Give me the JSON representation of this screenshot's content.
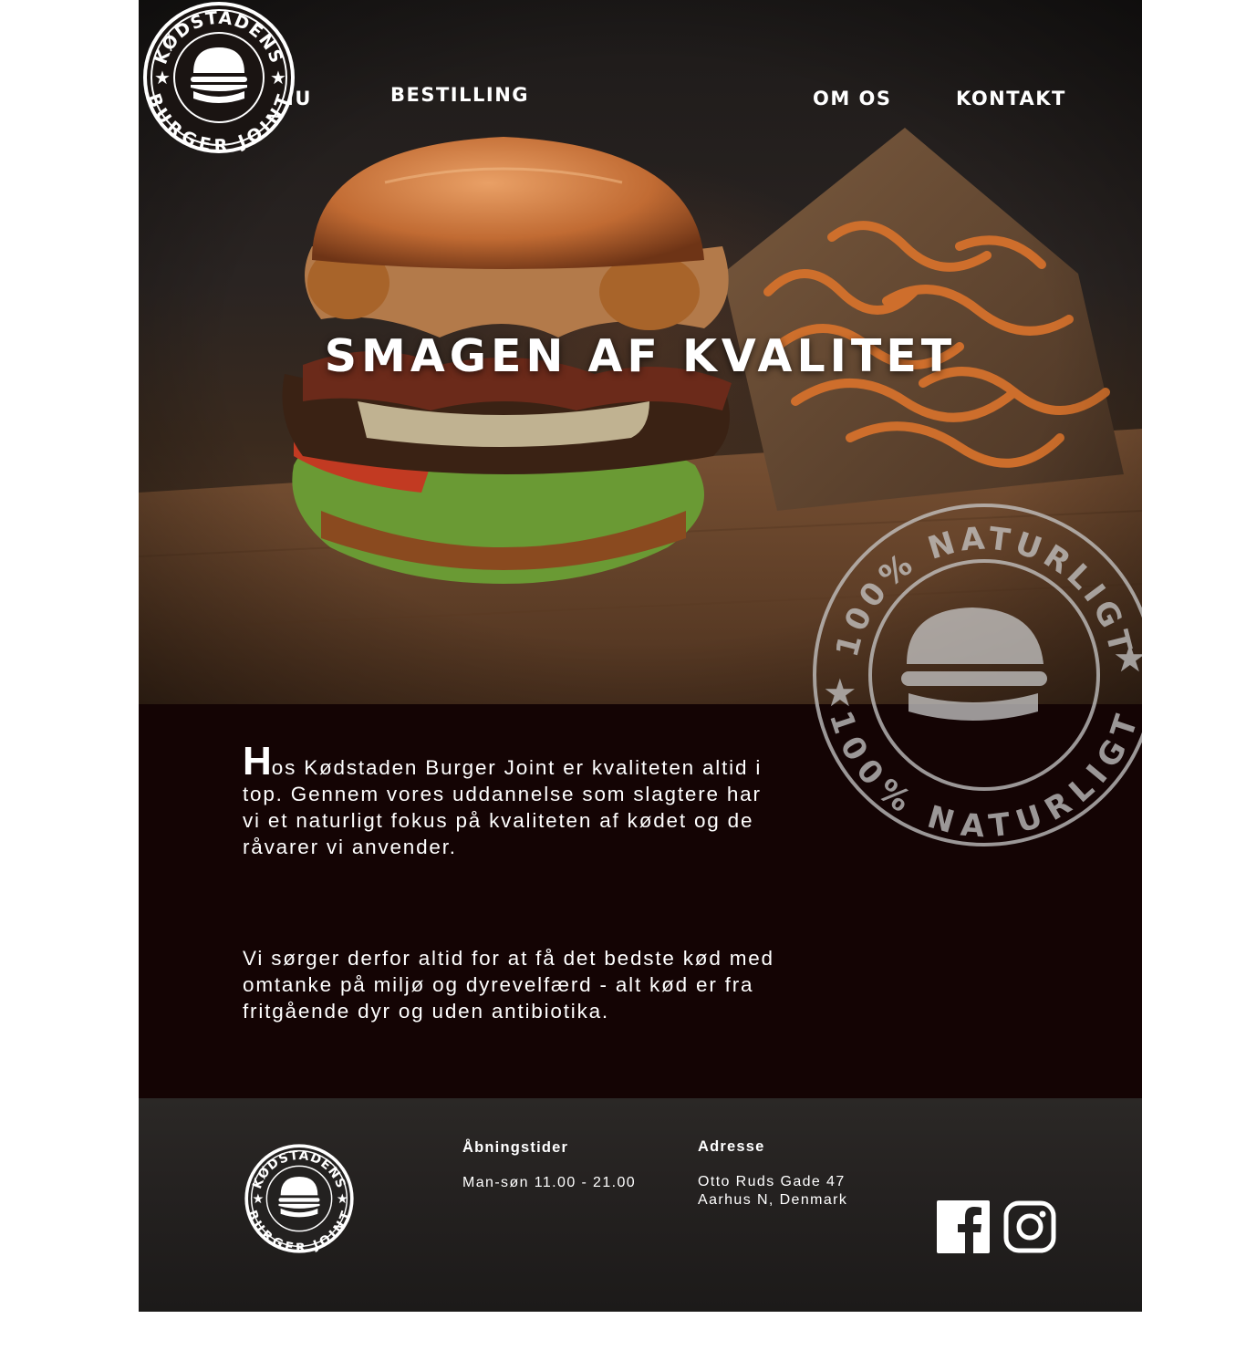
{
  "nav": {
    "menu": "Menu",
    "bestilling": "Bestilling",
    "om_os": "Om os",
    "kontakt": "Kontakt"
  },
  "logo": {
    "top_text": "KØDSTADENS",
    "bottom_text": "BURGER JOINT"
  },
  "hero": {
    "title": "Smagen af kvalitet"
  },
  "content": {
    "para1_initial": "H",
    "para1_rest": "os Kødstaden Burger Joint er kvaliteten altid i top. Gennem vores uddannelse som slagtere har vi et naturligt fokus på kvaliteten af kødet og de råvarer vi anvender.",
    "para2": "Vi sørger derfor altid for at få det bedste kød med omtanke på miljø og dyrevelfærd - alt kød er fra fritgående dyr og uden antibiotika."
  },
  "badge": {
    "text_top": "100% NATURLIGT",
    "text_bottom": "100% NATURLIGT"
  },
  "footer": {
    "hours_heading": "Åbningstider",
    "hours": "Man-søn 11.00 - 21.00",
    "address_heading": "Adresse",
    "address_line1": "Otto Ruds Gade 47",
    "address_line2": "Aarhus N, Denmark"
  },
  "social": {
    "facebook_icon": "facebook-icon",
    "instagram_icon": "instagram-icon"
  },
  "colors": {
    "content_bg": "#140404",
    "text": "#ffffff",
    "badge": "#c8c8c8"
  }
}
